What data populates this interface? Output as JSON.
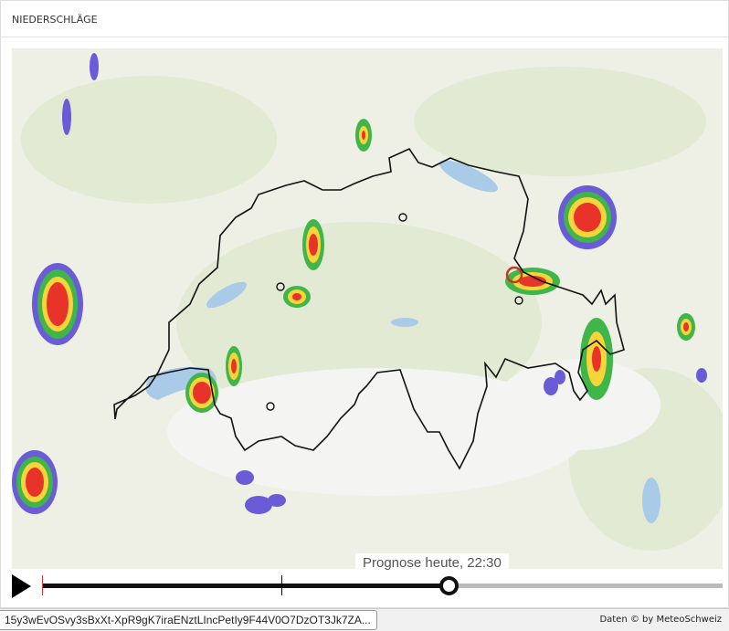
{
  "panel": {
    "title": "NIEDERSCHLÄGE"
  },
  "timeline": {
    "label": "Prognose heute, 22:30",
    "progress": 0.597,
    "now_marker": 0.352,
    "play_icon": "play-icon"
  },
  "status": {
    "url": "15y3wEvOSvy3sBxXt-XpR9gK7iraENztLIncPetIy9F44V0O7DzOT3Jk7ZA...",
    "credit": "Daten © by MeteoSchweiz"
  },
  "colors": {
    "border": "#111111",
    "lake": "#a9cbe8",
    "rain_low": "#6a5cd6",
    "rain_mid": "#3fb54a",
    "rain_high": "#f7d43a",
    "rain_max": "#e8332a"
  }
}
